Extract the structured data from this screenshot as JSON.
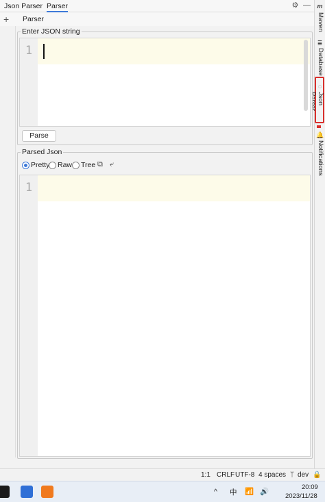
{
  "toolwindow": {
    "tabs": [
      "Json Parser",
      "Parser"
    ],
    "sub_tab": "Parser",
    "add_symbol": "+"
  },
  "right_stripe": {
    "items": [
      "Maven",
      "Database",
      "Json Parser",
      "Notifications"
    ]
  },
  "input_panel": {
    "title": "Enter JSON string",
    "line_number": "1",
    "parse_button": "Parse"
  },
  "output_panel": {
    "title": "Parsed Json",
    "modes": [
      "Pretty",
      "Raw",
      "Tree"
    ],
    "selected_mode": "Pretty",
    "line_number": "1"
  },
  "statusbar": {
    "position": "1:1",
    "line_ending": "CRLF",
    "encoding": "UTF-8",
    "indent": "4 spaces",
    "branch": "dev"
  },
  "taskbar": {
    "ime": "中",
    "time": "20:09",
    "date": "2023/11/28"
  },
  "colors": {
    "accent": "#3d79d8",
    "highlight_border": "#d9302c"
  }
}
